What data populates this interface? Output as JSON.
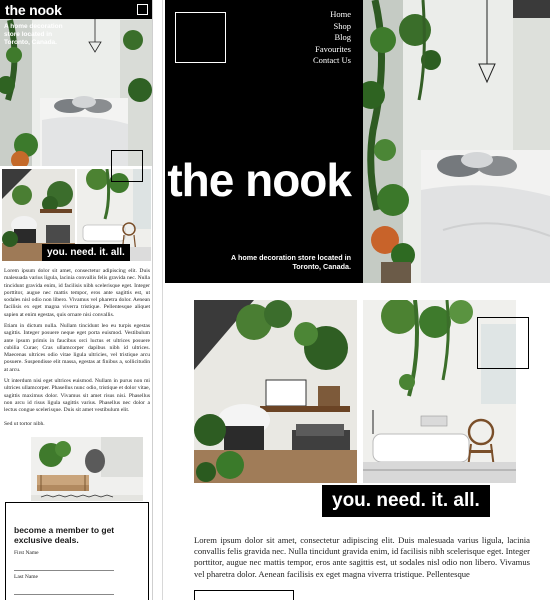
{
  "mobile": {
    "logo": "the nook",
    "tagline": "A home decoration store located in Toronto, Canada.",
    "slogan": "you. need. it. all.",
    "paragraphs": [
      "Lorem ipsum dolor sit amet, consectetur adipiscing elit. Duis malesuada varius ligula, lacinia convallis felis gravida nec. Nulla tincidunt gravida enim, id facilisis nibh scelerisque eget. Integer porttitor, augue nec mattis tempor, eros ante sagittis est, ut sodales nisl odio non libero. Vivamus vel pharetra dolor. Aenean facilisis ex eget magna viverra tristique. Pellentesque aliquet sapien at enim egestas, quis ornare nisi convallis.",
      "Etiam in dictum nulla. Nullam tincidunt leo eu turpis egestas sagittis. Integer posuere neque eget porta euismod. Vestibulum ante ipsum primis in faucibus orci luctus et ultrices posuere cubilia Curae; Cras ullamcorper dapibus nibh id ultrices. Maecenas ultrices odio vitae ligula ultricies, vel tristique arcu posuere. Suspendisse elit massa, egestas at finibus a, sollicitudin at arcu.",
      "Ut interdum nisi eget ultrices euismod. Nullam in purus non mi ultrices ullamcorper. Phasellus nunc odio, tristique et dolor vitae, sagittis maximus dolor. Vivamus sit amet risus nisi. Phasellus non arcu id risus ligula sagittis varius. Phasellus nec dolor a lectus congue scelerisque. Duis sit amet vestibulum elit.",
      "Sed ut tortor nibh."
    ],
    "signup": {
      "heading": "become a member to get exclusive deals.",
      "first_name_label": "First Name",
      "last_name_label": "Last Name"
    }
  },
  "desktop": {
    "title": "the nook",
    "tagline": "A home decoration store located in Toronto, Canada.",
    "nav": [
      "Home",
      "Shop",
      "Blog",
      "Favourites",
      "Contact Us"
    ],
    "slogan": "you. need. it. all.",
    "body_text": "Lorem ipsum dolor sit amet, consectetur adipiscing elit. Duis malesuada varius ligula, lacinia convallis felis gravida nec. Nulla tincidunt gravida enim, id facilisis nibh scelerisque eget. Integer porttitor, augue nec mattis tempor, eros ante sagittis est, ut sodales nisl odio non libero. Vivamus vel pharetra dolor. Aenean facilisis ex eget magna viverra tristique. Pellentesque"
  },
  "colors": {
    "black": "#000000",
    "white": "#ffffff",
    "wall": "#e9ebe8",
    "bedding": "#ededec",
    "plant": "#3c6b2e",
    "wood": "#7a4f2a"
  }
}
